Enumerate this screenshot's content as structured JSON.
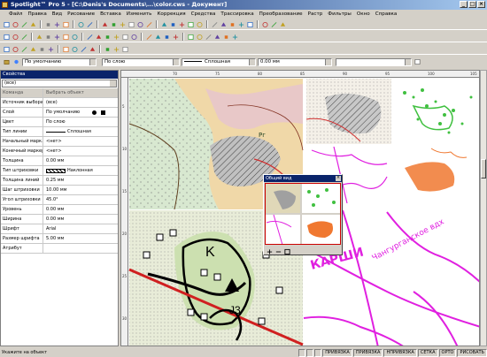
{
  "titlebar": {
    "title": "Spotlight™ Pro 5 - [C:\\Denis's Documents\\...\\color.cws - Документ]"
  },
  "menu": [
    "Файл",
    "Правка",
    "Вид",
    "Рисование",
    "Вставка",
    "Изменить",
    "Коррекция",
    "Средства",
    "Трассировка",
    "Преобразование",
    "Растр",
    "Фильтры",
    "Окно",
    "Справка"
  ],
  "toolbar_icons": {
    "row1": [
      "new-icon",
      "open-icon",
      "save-icon",
      "print-icon",
      "cut-icon",
      "copy-icon",
      "paste-icon",
      "undo-icon",
      "redo-icon",
      "zoom-in-icon",
      "zoom-out-icon",
      "pan-icon",
      "grid-icon",
      "refresh-icon",
      "layers-icon",
      "tools-icon",
      "delete-icon",
      "select-icon",
      "line-icon",
      "polyline-icon",
      "circle-icon",
      "rotate-icon",
      "scan-icon",
      "settings-icon",
      "raster-icon",
      "filter-icon",
      "window-icon",
      "help-icon"
    ],
    "row2": [
      "pointer-icon",
      "node-icon",
      "move-icon",
      "rotate-icon",
      "scale-icon",
      "mirror-icon",
      "align-icon",
      "trim-icon",
      "extend-icon",
      "join-icon",
      "break-icon",
      "fillet-icon",
      "chamfer-icon",
      "offset-icon",
      "trace-icon",
      "vectorize-icon",
      "clean-icon",
      "despeckle-icon",
      "fill-icon",
      "erase-icon",
      "brush-icon",
      "pencil-icon",
      "lasso-icon",
      "wand-icon"
    ],
    "row3": [
      "line-tool-icon",
      "arc-tool-icon",
      "circle-tool-icon",
      "rect-tool-icon",
      "polygon-tool-icon",
      "text-tool-icon",
      "dim-tool-icon",
      "hatch-tool-icon",
      "symbol-tool-icon",
      "curve-tool-icon",
      "point-tool-icon",
      "measure-tool-icon",
      "snap-tool-icon"
    ]
  },
  "propbar": {
    "layer": "По умолчанию",
    "color": "По слою",
    "linetype": "Сплошная",
    "width": "0.00 мм"
  },
  "panel": {
    "title": "Свойства",
    "combo": "(все)",
    "header": {
      "key": "Команда",
      "value": "Выбрать объект"
    },
    "rows": [
      {
        "k": "Источник выбора",
        "v": "(все)"
      },
      {
        "k": "Слой",
        "v": "По умолчанию"
      },
      {
        "k": "Цвет",
        "v": "По слою"
      },
      {
        "k": "Тип линии",
        "v": "Сплошная"
      },
      {
        "k": "Начальный марк...",
        "v": "<нет>"
      },
      {
        "k": "Конечный маркер",
        "v": "<нет>"
      },
      {
        "k": "Толщина",
        "v": "0.00 мм"
      },
      {
        "k": "Тип штриховки",
        "v": "Наклонная"
      },
      {
        "k": "Толщина линий",
        "v": "0.25 мм"
      },
      {
        "k": "Шаг штриховки",
        "v": "10.00 мм"
      },
      {
        "k": "Угол штриховки",
        "v": "45.0°"
      },
      {
        "k": "Уровень",
        "v": "0.00 мм"
      },
      {
        "k": "Ширина",
        "v": "0.00 мм"
      },
      {
        "k": "Шрифт",
        "v": "Arial"
      },
      {
        "k": "Размер шрифта",
        "v": "5.00 мм"
      },
      {
        "k": "Атрибут",
        "v": ""
      }
    ]
  },
  "ruler": {
    "h": [
      "70",
      "75",
      "80",
      "85",
      "90",
      "95",
      "100",
      "105"
    ],
    "v": [
      "5",
      "10",
      "15",
      "20",
      "25",
      "30"
    ]
  },
  "map": {
    "label1": "K",
    "label2": "J3",
    "label3": "КАРШИ",
    "label4": "Чангурганское вдх",
    "label5": "Рг"
  },
  "overview": {
    "title": "Общий вид"
  },
  "statusbar": {
    "message": "Укажите на объект",
    "buttons": [
      "ПРИВЯЗКА",
      "ПРИВЯЗКА",
      "НПРИВЯЗКА",
      "СЕТКА",
      "ОРТО",
      "РИСОВАТЬ"
    ]
  },
  "colors": {
    "accent": "#0a246a",
    "magenta": "#e020e0",
    "green": "#40c040",
    "orange": "#f07830"
  }
}
